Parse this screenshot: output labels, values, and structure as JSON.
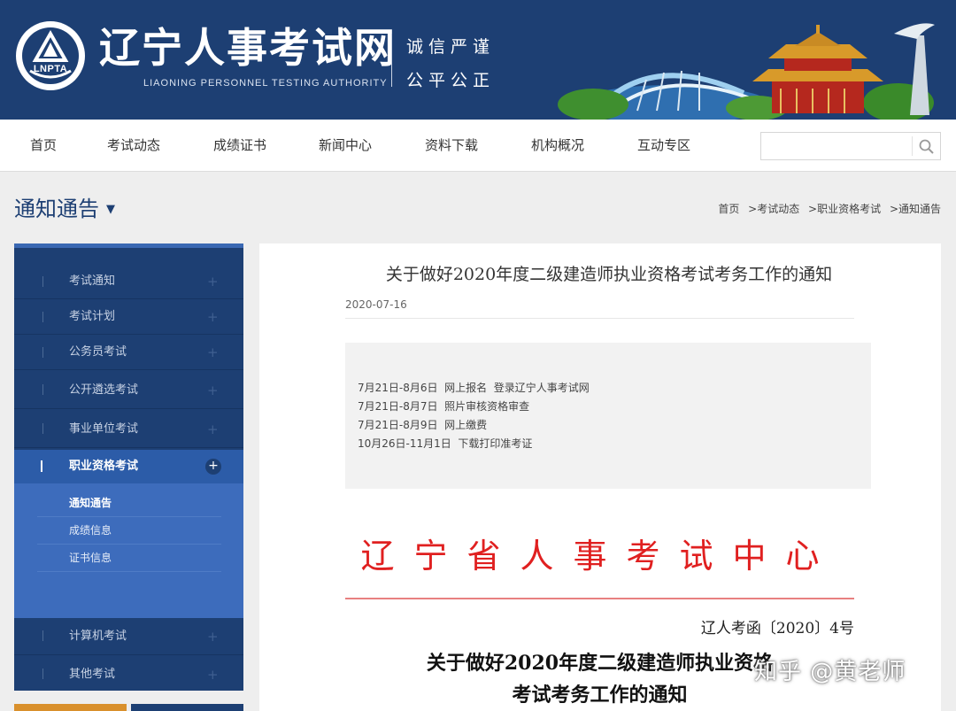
{
  "header": {
    "logo_abbr": "LNPTA",
    "title": "辽宁人事考试网",
    "subtitle": "LIAONING PERSONNEL TESTING AUTHORITY",
    "slogan_line1": "诚信严谨",
    "slogan_line2": "公平公正",
    "colors": {
      "band": "#1d3f73"
    }
  },
  "nav": {
    "items": [
      {
        "label": "首页"
      },
      {
        "label": "考试动态"
      },
      {
        "label": "成绩证书"
      },
      {
        "label": "新闻中心"
      },
      {
        "label": "资料下载"
      },
      {
        "label": "机构概况"
      },
      {
        "label": "互动专区"
      }
    ],
    "search": {
      "value": "",
      "icon": "search-icon"
    }
  },
  "page": {
    "section_title": "通知通告",
    "breadcrumb": [
      "首页",
      ">考试动态",
      ">职业资格考试",
      ">通知通告"
    ]
  },
  "sidebar": {
    "items_top": [
      {
        "label": "考试通知"
      },
      {
        "label": "考试计划"
      },
      {
        "label": "公务员考试"
      },
      {
        "label": "公开遴选考试"
      },
      {
        "label": "事业单位考试"
      }
    ],
    "active": {
      "label": "职业资格考试"
    },
    "sub_items": [
      {
        "label": "通知通告"
      },
      {
        "label": "成绩信息"
      },
      {
        "label": "证书信息"
      }
    ],
    "items_bottom": [
      {
        "label": "计算机考试"
      },
      {
        "label": "其他考试"
      }
    ]
  },
  "article": {
    "title": "关于做好2020年度二级建造师执业资格考试考务工作的通知",
    "date": "2020-07-16",
    "summary_lines": [
      "7月21日-8月6日  网上报名  登录辽宁人事考试网",
      "7月21日-8月7日  照片审核资格审查",
      "7月21日-8月9日  网上缴费",
      "10月26日-11月1日  下载打印准考证"
    ],
    "doc_org": "辽宁省人事考试中心",
    "doc_number": "辽人考函〔2020〕4号",
    "doc_title_line1": "关于做好2020年度二级建造师执业资格",
    "doc_title_line2": "考试考务工作的通知"
  },
  "watermark": "知乎 @黄老师"
}
